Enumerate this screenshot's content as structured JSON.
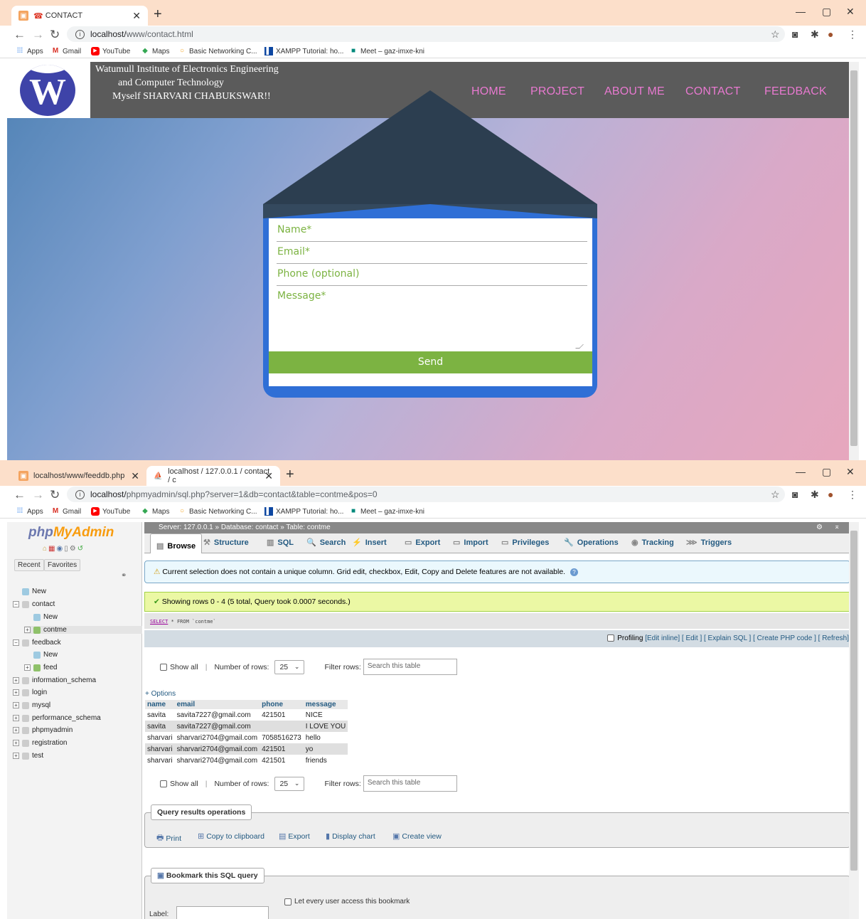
{
  "win1": {
    "tab": {
      "title": "CONTACT",
      "favicon": "☎"
    },
    "url_host": "localhost/",
    "url_path": "www/contact.html",
    "bookmarks": [
      "Apps",
      "Gmail",
      "YouTube",
      "Maps",
      "Basic Networking C...",
      "XAMPP Tutorial: ho...",
      "Meet – gaz-imxe-kni"
    ],
    "header": {
      "logo_letter": "W",
      "line1": "Watumull Institute of Electronics Engineering",
      "line2": "and Computer Technology",
      "line3": "Myself SHARVARI CHABUKSWAR!!"
    },
    "menu": [
      "HOME",
      "PROJECT",
      "ABOUT ME",
      "CONTACT",
      "FEEDBACK"
    ],
    "form": {
      "name_placeholder": "Name*",
      "email_placeholder": "Email*",
      "phone_placeholder": "Phone (optional)",
      "message_placeholder": "Message*",
      "send_label": "Send"
    }
  },
  "win2": {
    "tabs": [
      {
        "title": "localhost/www/feeddb.php"
      },
      {
        "title": "localhost / 127.0.0.1 / contact / c"
      }
    ],
    "url_host": "localhost/",
    "url_path": "phpmyadmin/sql.php?server=1&db=contact&table=contme&pos=0",
    "bookmarks": [
      "Apps",
      "Gmail",
      "YouTube",
      "Maps",
      "Basic Networking C...",
      "XAMPP Tutorial: ho...",
      "Meet – gaz-imxe-kni"
    ],
    "sidebar": {
      "logo_a": "php",
      "logo_b": "MyAdmin",
      "recent": "Recent",
      "favorites": "Favorites",
      "tree": [
        {
          "label": "New",
          "level": 0
        },
        {
          "label": "contact",
          "level": 0
        },
        {
          "label": "New",
          "level": 1
        },
        {
          "label": "contme",
          "level": 1
        },
        {
          "label": "feedback",
          "level": 0
        },
        {
          "label": "New",
          "level": 1
        },
        {
          "label": "feed",
          "level": 1
        },
        {
          "label": "information_schema",
          "level": 0
        },
        {
          "label": "login",
          "level": 0
        },
        {
          "label": "mysql",
          "level": 0
        },
        {
          "label": "performance_schema",
          "level": 0
        },
        {
          "label": "phpmyadmin",
          "level": 0
        },
        {
          "label": "registration",
          "level": 0
        },
        {
          "label": "test",
          "level": 0
        }
      ]
    },
    "breadcrumb": "Server: 127.0.0.1 » Database: contact » Table: contme",
    "tabs_pma": [
      "Browse",
      "Structure",
      "SQL",
      "Search",
      "Insert",
      "Export",
      "Import",
      "Privileges",
      "Operations",
      "Tracking",
      "Triggers"
    ],
    "notice": "Current selection does not contain a unique column. Grid edit, checkbox, Edit, Copy and Delete features are not available.",
    "success": "Showing rows 0 - 4 (5 total, Query took 0.0007 seconds.)",
    "sql": {
      "select": "SELECT",
      "rest": " * FROM `contme`"
    },
    "profiling": {
      "label": "Profiling",
      "links": "[Edit inline] [ Edit ] [ Explain SQL ] [ Create PHP code ] [ Refresh]"
    },
    "nav": {
      "show_all": "Show all",
      "rows_label": "Number of rows:",
      "rows_value": "25",
      "filter_label": "Filter rows:",
      "filter_placeholder": "Search this table"
    },
    "options": "+ Options",
    "table": {
      "columns": [
        "name",
        "email",
        "phone",
        "message"
      ],
      "rows": [
        [
          "savita",
          "savita7227@gmail.com",
          "421501",
          "NICE"
        ],
        [
          "savita",
          "savita7227@gmail.com",
          "",
          "I LOVE YOU"
        ],
        [
          "sharvari",
          "sharvari2704@gmail.com",
          "7058516273",
          "hello"
        ],
        [
          "sharvari",
          "sharvari2704@gmail.com",
          "421501",
          "yo"
        ],
        [
          "sharvari",
          "sharvari2704@gmail.com",
          "421501",
          "friends"
        ]
      ]
    },
    "qro": {
      "legend": "Query results operations",
      "print": "Print",
      "copy": "Copy to clipboard",
      "export": "Export",
      "chart": "Display chart",
      "view": "Create view"
    },
    "bookmark": {
      "legend": "Bookmark this SQL query",
      "label": "Label:",
      "every_user": "Let every user access this bookmark"
    }
  }
}
